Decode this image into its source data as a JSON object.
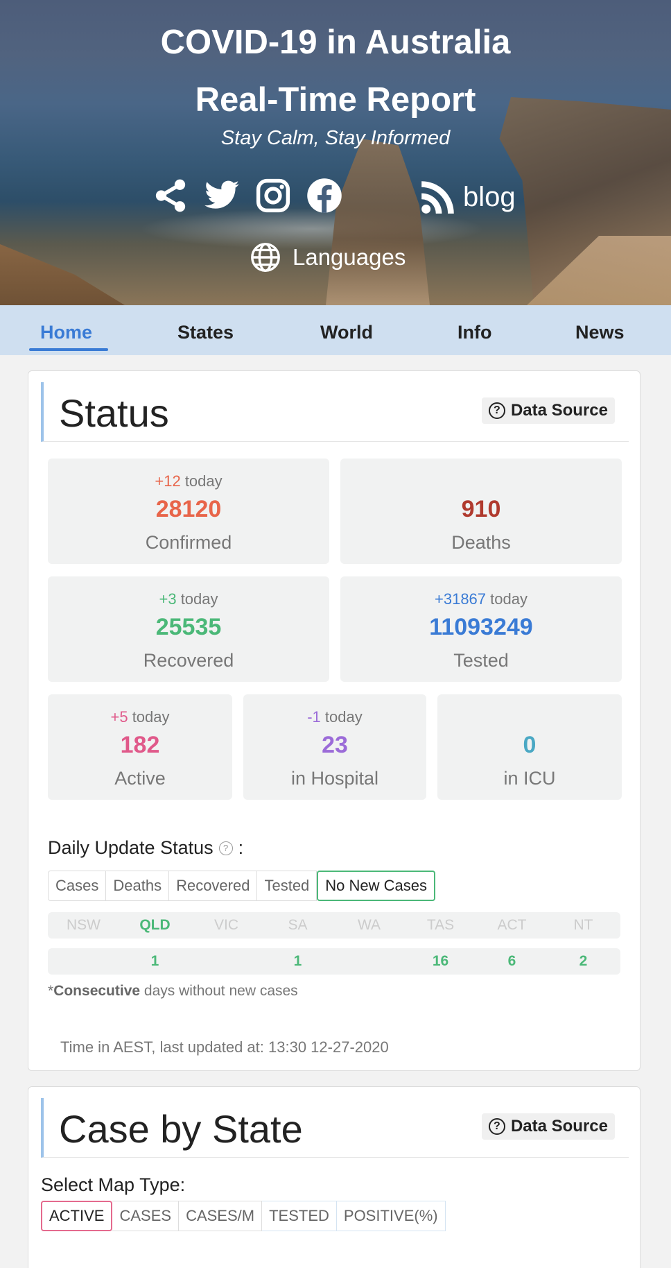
{
  "header": {
    "title_line1": "COVID-19 in Australia",
    "title_line2": "Real-Time Report",
    "tagline": "Stay Calm, Stay Informed",
    "social_icons": [
      "share-icon",
      "twitter-icon",
      "instagram-icon",
      "facebook-icon"
    ],
    "blog_label": "blog",
    "languages_label": "Languages"
  },
  "nav": {
    "items": [
      {
        "label": "Home",
        "active": true
      },
      {
        "label": "States",
        "active": false
      },
      {
        "label": "World",
        "active": false
      },
      {
        "label": "Info",
        "active": false
      },
      {
        "label": "News",
        "active": false
      }
    ]
  },
  "status": {
    "title": "Status",
    "data_source_label": "Data Source",
    "today_word": "today",
    "stats": {
      "confirmed": {
        "delta": "+12",
        "value": "28120",
        "label": "Confirmed",
        "color": "#e8654a"
      },
      "deaths": {
        "value": "910",
        "label": "Deaths",
        "color": "#b03a2e"
      },
      "recovered": {
        "delta": "+3",
        "value": "25535",
        "label": "Recovered",
        "color": "#4bb878"
      },
      "tested": {
        "delta": "+31867",
        "value": "11093249",
        "label": "Tested",
        "color": "#3a7bd5"
      },
      "active": {
        "delta": "+5",
        "value": "182",
        "label": "Active",
        "color": "#e0598a"
      },
      "hospital": {
        "delta": "-1",
        "value": "23",
        "label": "in Hospital",
        "color": "#9b6bd8"
      },
      "icu": {
        "value": "0",
        "label": "in ICU",
        "color": "#4aa8c4"
      }
    },
    "daily_update_label": "Daily Update Status",
    "daily_tabs": [
      "Cases",
      "Deaths",
      "Recovered",
      "Tested",
      "No New Cases"
    ],
    "daily_selected": "No New Cases",
    "states": [
      "NSW",
      "QLD",
      "VIC",
      "SA",
      "WA",
      "TAS",
      "ACT",
      "NT"
    ],
    "highlight_state": "QLD",
    "state_values": [
      "",
      "1",
      "",
      "1",
      "",
      "16",
      "6",
      "2"
    ],
    "note_prefix": "*",
    "note_bold": "Consecutive",
    "note_rest": " days without new cases",
    "updated_text": "Time in AEST, last updated at: 13:30 12-27-2020"
  },
  "case_by_state": {
    "title": "Case by State",
    "data_source_label": "Data Source",
    "select_label": "Select Map Type:",
    "map_tabs": [
      "ACTIVE",
      "CASES",
      "CASES/M",
      "TESTED",
      "POSITIVE(%)"
    ],
    "selected": "ACTIVE"
  }
}
